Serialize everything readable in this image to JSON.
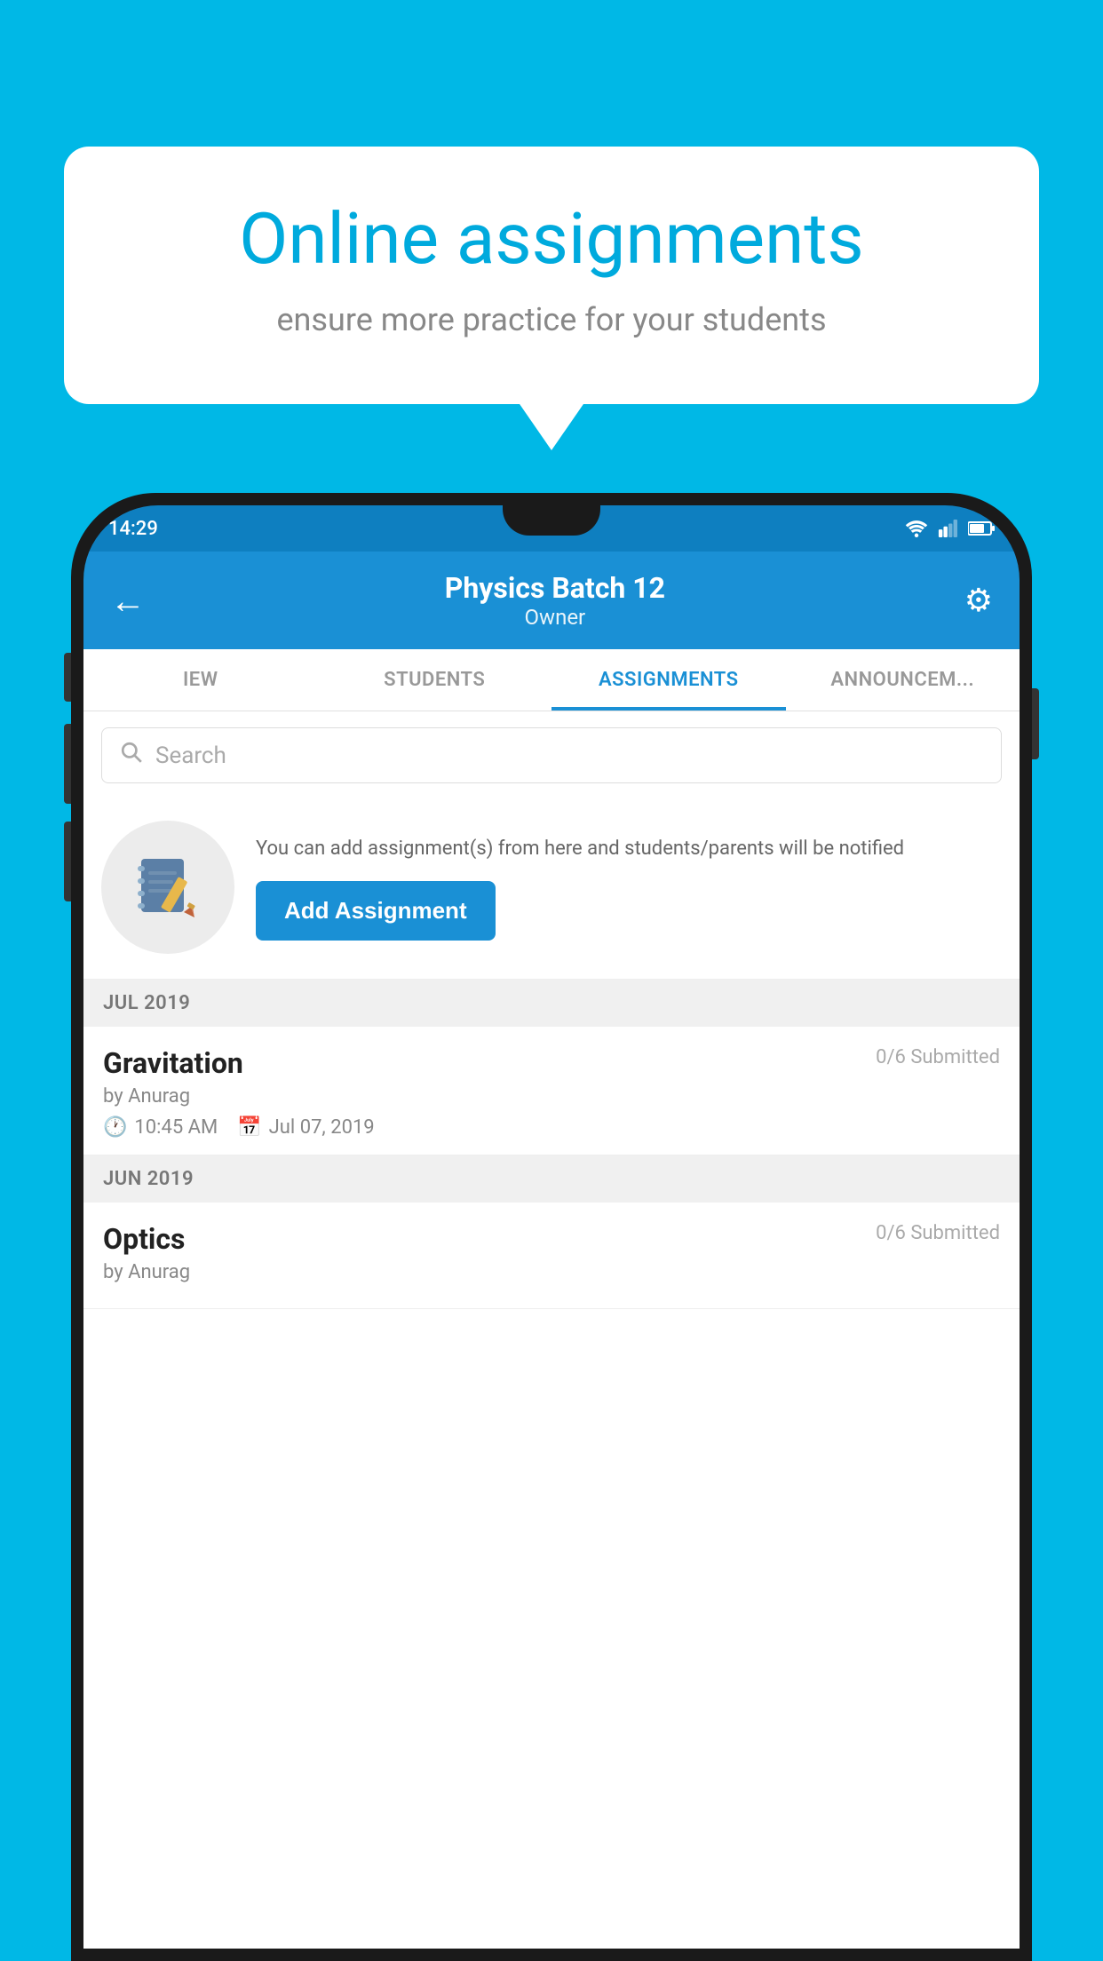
{
  "background_color": "#00b8e6",
  "speech_bubble": {
    "title": "Online assignments",
    "subtitle": "ensure more practice for your students"
  },
  "phone": {
    "status_bar": {
      "time": "14:29"
    },
    "app_bar": {
      "title": "Physics Batch 12",
      "subtitle": "Owner",
      "back_label": "←",
      "settings_label": "⚙"
    },
    "tabs": [
      {
        "label": "IEW",
        "active": false
      },
      {
        "label": "STUDENTS",
        "active": false
      },
      {
        "label": "ASSIGNMENTS",
        "active": true
      },
      {
        "label": "ANNOUNCEM...",
        "active": false
      }
    ],
    "search": {
      "placeholder": "Search"
    },
    "promo": {
      "description": "You can add assignment(s) from here and students/parents will be notified",
      "button_label": "Add Assignment"
    },
    "sections": [
      {
        "month_label": "JUL 2019",
        "assignments": [
          {
            "title": "Gravitation",
            "submitted": "0/6 Submitted",
            "by": "by Anurag",
            "time": "10:45 AM",
            "date": "Jul 07, 2019"
          }
        ]
      },
      {
        "month_label": "JUN 2019",
        "assignments": [
          {
            "title": "Optics",
            "submitted": "0/6 Submitted",
            "by": "by Anurag",
            "time": "",
            "date": ""
          }
        ]
      }
    ]
  }
}
